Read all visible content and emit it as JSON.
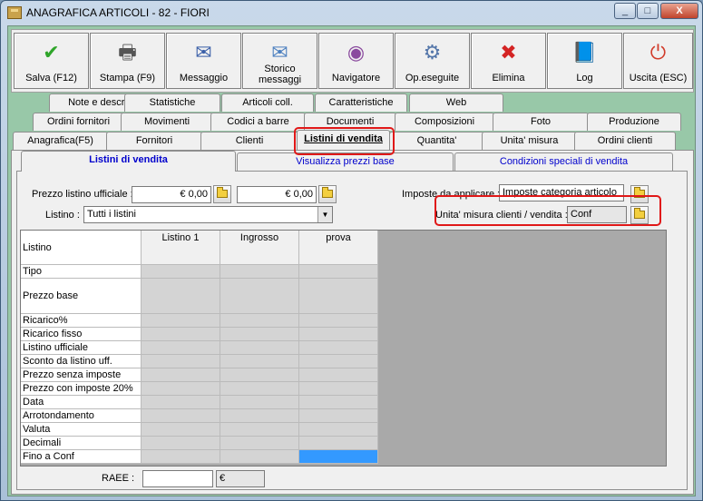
{
  "window": {
    "title": "ANAGRAFICA ARTICOLI - 82 - FIORI",
    "minimize": "_",
    "maximize": "□",
    "close": "X"
  },
  "toolbar": [
    {
      "id": "save",
      "label": "Salva (F12)",
      "icon": "check-icon",
      "glyph": "✔",
      "color": "#2fa52a"
    },
    {
      "id": "print",
      "label": "Stampa (F9)",
      "icon": "printer-icon",
      "glyph": "🖶",
      "color": "#555555"
    },
    {
      "id": "message",
      "label": "Messaggio",
      "icon": "envelope-pen-icon",
      "glyph": "✉",
      "color": "#3a5fa8"
    },
    {
      "id": "history",
      "label": "Storico\nmessaggi",
      "icon": "envelope-search-icon",
      "glyph": "✉",
      "color": "#4b7fbf"
    },
    {
      "id": "navigator",
      "label": "Navigatore",
      "icon": "compass-icon",
      "glyph": "◉",
      "color": "#8a4a9e"
    },
    {
      "id": "ops",
      "label": "Op.eseguite",
      "icon": "gears-icon",
      "glyph": "⚙",
      "color": "#5577aa"
    },
    {
      "id": "delete",
      "label": "Elimina",
      "icon": "red-x-icon",
      "glyph": "✖",
      "color": "#d42424"
    },
    {
      "id": "log",
      "label": "Log",
      "icon": "book-search-icon",
      "glyph": "📘",
      "color": "#2a6ac4"
    },
    {
      "id": "exit",
      "label": "Uscita (ESC)",
      "icon": "power-icon",
      "glyph": "⏻",
      "color": "#d13b2a"
    }
  ],
  "tabs_row1": [
    "Note e descr.",
    "Statistiche",
    "Articoli coll.",
    "Caratteristiche",
    "Web"
  ],
  "tabs_row2": [
    "Ordini fornitori",
    "Movimenti",
    "Codici a barre",
    "Documenti",
    "Composizioni",
    "Foto",
    "Produzione"
  ],
  "tabs_row3": [
    "Anagrafica(F5)",
    "Fornitori",
    "Clienti",
    "Listini di vendita",
    "Quantita'",
    "Unita' misura",
    "Ordini clienti"
  ],
  "active_tab": "Listini di vendita",
  "subtabs": [
    "Listini di vendita",
    "Visualizza prezzi base",
    "Condizioni speciali di vendita"
  ],
  "form": {
    "prezzo_label": "Prezzo listino ufficiale :",
    "prezzo_value1": "€ 0,00",
    "prezzo_value2": "€ 0,00",
    "imposte_label": "Imposte da applicare :",
    "imposte_value": "Imposte categoria articolo",
    "listino_label": "Listino :",
    "listino_value": "Tutti i listini",
    "um_label": "Unita' misura clienti / vendita :",
    "um_value": "Conf",
    "raee_label": "RAEE :",
    "raee_value": "",
    "raee_unit": "€"
  },
  "grid": {
    "corner": "Listino",
    "columns": [
      "Listino 1",
      "Ingrosso",
      "prova"
    ],
    "rows": [
      "Tipo",
      "Prezzo base",
      "Ricarico%",
      "Ricarico fisso",
      "Listino ufficiale",
      "Sconto da listino uff.",
      "Prezzo senza imposte",
      "Prezzo con imposte 20%",
      "Data",
      "Arrotondamento",
      "Valuta",
      "Decimali",
      "Fino a Conf"
    ]
  }
}
